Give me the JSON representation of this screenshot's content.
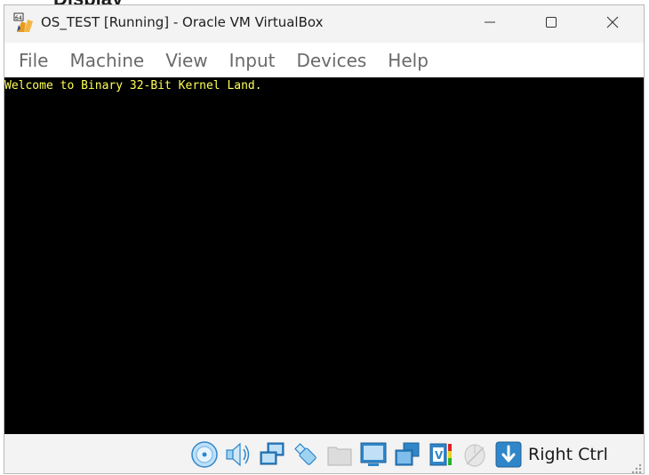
{
  "window": {
    "title": "OS_TEST [Running] - Oracle VM VirtualBox",
    "app_icon": "virtualbox-64-icon",
    "controls": {
      "minimize": "minimize-icon",
      "maximize": "maximize-icon",
      "close": "close-icon"
    }
  },
  "background_window_text": "Display",
  "menu": {
    "items": [
      {
        "label": "File"
      },
      {
        "label": "Machine"
      },
      {
        "label": "View"
      },
      {
        "label": "Input"
      },
      {
        "label": "Devices"
      },
      {
        "label": "Help"
      }
    ]
  },
  "console": {
    "line": "Welcome to Binary 32-Bit Kernel Land.",
    "text_color": "#ffff55",
    "background": "#000000"
  },
  "statusbar": {
    "icons": [
      "optical-drive-icon",
      "audio-icon",
      "network-icon",
      "usb-icon",
      "shared-folders-icon",
      "display-icon",
      "recording-icon",
      "vt-x-icon",
      "mouse-integration-icon",
      "keyboard-capture-icon"
    ],
    "host_key": "Right Ctrl"
  }
}
